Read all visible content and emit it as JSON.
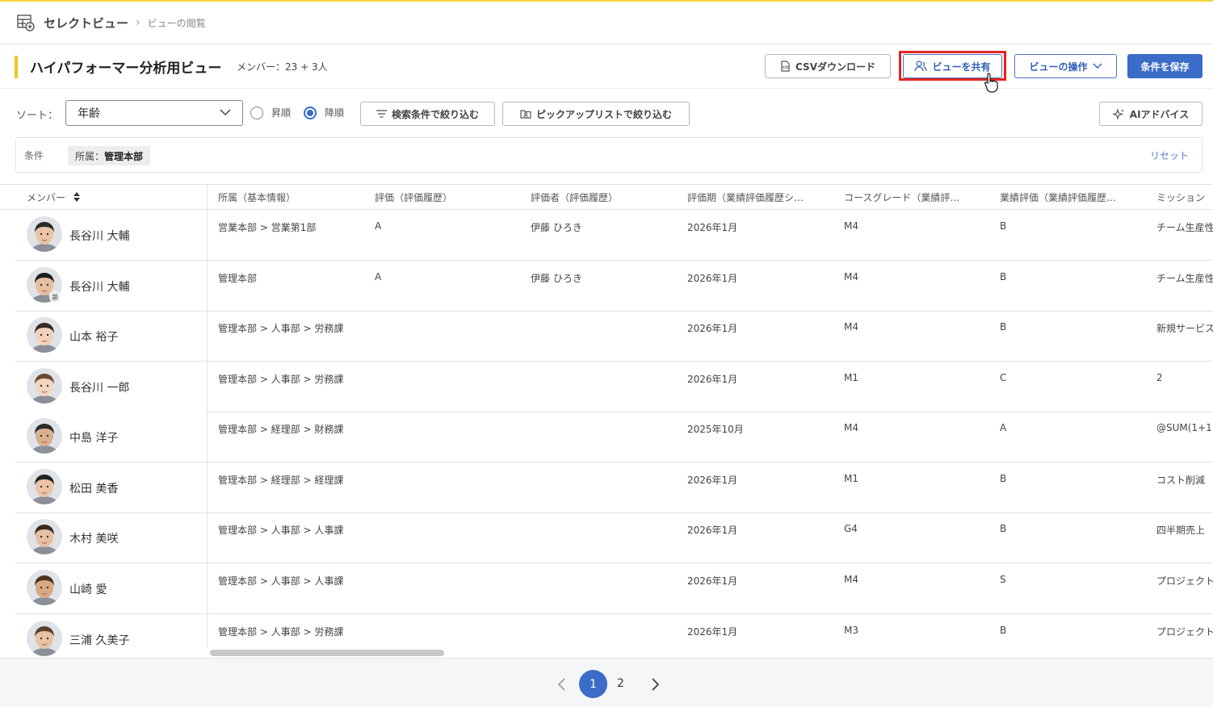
{
  "breadcrumb": {
    "root": "セレクトビュー",
    "current": "ビューの閲覧"
  },
  "header": {
    "title": "ハイパフォーマー分析用ビュー",
    "members": "メンバー：23 + 3人",
    "csv_label": "CSVダウンロード",
    "share_label": "ビューを共有",
    "ops_label": "ビューの操作",
    "save_label": "条件を保存"
  },
  "sort": {
    "label": "ソート：",
    "selected": "年齢",
    "asc_label": "昇順",
    "desc_label": "降順",
    "desc_selected": true,
    "filter_search_label": "検索条件で絞り込む",
    "filter_pickup_label": "ピックアップリストで絞り込む",
    "ai_label": "AIアドバイス"
  },
  "conditions": {
    "label": "条件",
    "chip_key": "所属：",
    "chip_value": "管理本部",
    "reset_label": "リセット"
  },
  "table": {
    "member_header": "メンバー",
    "columns": [
      "所属（基本情報）",
      "評価（評価履歴）",
      "評価者（評価履歴）",
      "評価期（業績評価履歴シ…",
      "コースグレード（業績評…",
      "業績評価（業績評価履歴…",
      "ミッション"
    ],
    "rows": [
      {
        "name": "長谷川 大輔",
        "dept": "営業本部 > 営業第1部",
        "rating": "A",
        "rater": "伊藤 ひろき",
        "period": "2026年1月",
        "grade": "M4",
        "perf": "B",
        "mission": "チーム生産性"
      },
      {
        "name": "長谷川 大輔",
        "badge": "兼",
        "dept": "管理本部",
        "rating": "A",
        "rater": "伊藤 ひろき",
        "period": "2026年1月",
        "grade": "M4",
        "perf": "B",
        "mission": "チーム生産性"
      },
      {
        "name": "山本 裕子",
        "dept": "管理本部 > 人事部 > 労務課",
        "rating": "",
        "rater": "",
        "period": "2026年1月",
        "grade": "M4",
        "perf": "B",
        "mission": "新規サービス"
      },
      {
        "name": "長谷川 一郎",
        "dept": "管理本部 > 人事部 > 労務課",
        "rating": "",
        "rater": "",
        "period": "2026年1月",
        "grade": "M1",
        "perf": "C",
        "mission": "2"
      },
      {
        "name": "中島 洋子",
        "dept": "管理本部 > 経理部 > 財務課",
        "rating": "",
        "rater": "",
        "period": "2025年10月",
        "grade": "M4",
        "perf": "A",
        "mission": "@SUM(1+1"
      },
      {
        "name": "松田 美香",
        "dept": "管理本部 > 経理部 > 経理課",
        "rating": "",
        "rater": "",
        "period": "2026年1月",
        "grade": "M1",
        "perf": "B",
        "mission": "コスト削減"
      },
      {
        "name": "木村 美咲",
        "dept": "管理本部 > 人事部 > 人事課",
        "rating": "",
        "rater": "",
        "period": "2026年1月",
        "grade": "G4",
        "perf": "B",
        "mission": "四半期売上"
      },
      {
        "name": "山崎 愛",
        "dept": "管理本部 > 人事部 > 人事課",
        "rating": "",
        "rater": "",
        "period": "2026年1月",
        "grade": "M4",
        "perf": "S",
        "mission": "プロジェクト"
      },
      {
        "name": "三浦 久美子",
        "dept": "管理本部 > 人事部 > 労務課",
        "rating": "",
        "rater": "",
        "period": "2026年1月",
        "grade": "M3",
        "perf": "B",
        "mission": "プロジェクト"
      }
    ]
  },
  "pager": {
    "page1": "1",
    "page2": "2"
  },
  "colors": {
    "accent": "#3a6cc8",
    "highlight": "#e8231c",
    "title_bar": "#f2c524"
  }
}
